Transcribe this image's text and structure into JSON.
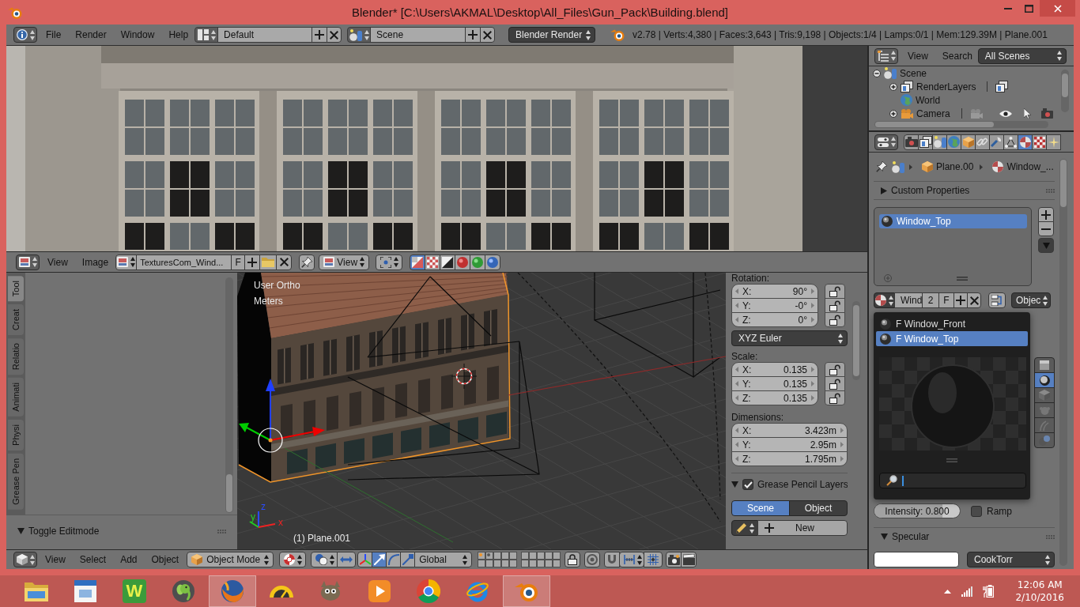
{
  "window": {
    "title": "Blender* [C:\\Users\\AKMAL\\Desktop\\All_Files\\Gun_Pack\\Building.blend]"
  },
  "info_header": {
    "menus": [
      "File",
      "Render",
      "Window",
      "Help"
    ],
    "layout": "Default",
    "scene": "Scene",
    "engine": "Blender Render",
    "stats": "v2.78 | Verts:4,380 | Faces:3,643 | Tris:9,198 | Objects:1/4 | Lamps:0/1 | Mem:129.39M | Plane.001"
  },
  "image_editor": {
    "menus": [
      "View",
      "Image"
    ],
    "image": "TexturesCom_Wind...",
    "fake_user": "F",
    "view_mode": "View",
    "channels": [
      {
        "kind": "color_alpha",
        "selected": true
      },
      {
        "kind": "alpha",
        "selected": false
      },
      {
        "kind": "z_buffer",
        "selected": false
      },
      {
        "kind": "red",
        "selected": false
      },
      {
        "kind": "green",
        "selected": false
      },
      {
        "kind": "blue",
        "selected": false
      }
    ]
  },
  "tool_shelf": {
    "tabs": [
      {
        "label": "Tool",
        "selected": true
      },
      {
        "label": "Creat",
        "selected": false
      },
      {
        "label": "Relatio",
        "selected": false
      },
      {
        "label": "Animati",
        "selected": false
      },
      {
        "label": "Physi",
        "selected": false
      },
      {
        "label": "Grease Pen",
        "selected": false
      }
    ],
    "operator_panel": {
      "title": "Toggle Editmode",
      "expanded": true
    }
  },
  "viewport": {
    "view": "User Ortho",
    "units": "Meters",
    "object": "(1) Plane.001",
    "axes": [
      "z",
      "y",
      "x"
    ]
  },
  "n_panel": {
    "rotation": {
      "label": "Rotation:",
      "fields": [
        {
          "axis": "X:",
          "value": "90°",
          "locked": false
        },
        {
          "axis": "Y:",
          "value": "-0°",
          "locked": false
        },
        {
          "axis": "Z:",
          "value": "0°",
          "locked": false
        }
      ]
    },
    "rotation_mode": "XYZ Euler",
    "scale": {
      "label": "Scale:",
      "fields": [
        {
          "axis": "X:",
          "value": "0.135",
          "locked": false
        },
        {
          "axis": "Y:",
          "value": "0.135",
          "locked": false
        },
        {
          "axis": "Z:",
          "value": "0.135",
          "locked": false
        }
      ]
    },
    "dimensions": {
      "label": "Dimensions:",
      "fields": [
        {
          "axis": "X:",
          "value": "3.423m"
        },
        {
          "axis": "Y:",
          "value": "2.95m"
        },
        {
          "axis": "Z:",
          "value": "1.795m"
        }
      ]
    },
    "grease_pencil": {
      "title": "Grease Pencil Layers",
      "expanded": true,
      "enabled": true,
      "sources": [
        {
          "label": "Scene",
          "selected": true
        },
        {
          "label": "Object",
          "selected": false
        }
      ],
      "new_label": "New"
    }
  },
  "view3d_header": {
    "menus": [
      "View",
      "Select",
      "Add",
      "Object"
    ],
    "mode": "Object Mode",
    "manipulators": [
      {
        "kind": "translate",
        "selected": true
      },
      {
        "kind": "rotate",
        "selected": false
      },
      {
        "kind": "scale",
        "selected": false
      }
    ],
    "orientation": "Global",
    "layers": [
      {
        "has_objects": true,
        "has_selected": true
      },
      {
        "has_objects": true,
        "has_selected": false
      },
      {
        "has_objects": false,
        "has_selected": false
      },
      {
        "has_objects": false,
        "has_selected": false
      },
      {
        "has_objects": false,
        "has_selected": false
      },
      {
        "has_objects": false,
        "has_selected": false
      },
      {
        "has_objects": false,
        "has_selected": false
      },
      {
        "has_objects": false,
        "has_selected": false
      },
      {
        "has_objects": false,
        "has_selected": false
      },
      {
        "has_objects": false,
        "has_selected": false
      },
      {
        "has_objects": false,
        "has_selected": false
      },
      {
        "has_objects": false,
        "has_selected": false
      },
      {
        "has_objects": false,
        "has_selected": false
      },
      {
        "has_objects": false,
        "has_selected": false
      },
      {
        "has_objects": false,
        "has_selected": false
      },
      {
        "has_objects": false,
        "has_selected": false
      },
      {
        "has_objects": false,
        "has_selected": false
      },
      {
        "has_objects": false,
        "has_selected": false
      },
      {
        "has_objects": false,
        "has_selected": false
      },
      {
        "has_objects": false,
        "has_selected": false
      }
    ]
  },
  "outliner": {
    "menus": [
      "View",
      "Search"
    ],
    "filter": "All Scenes",
    "tree": [
      {
        "label": "Scene",
        "kind": "scene",
        "expanded": true,
        "children": [
          {
            "label": "RenderLayers",
            "kind": "render_layers",
            "expanded": false
          },
          {
            "label": "World",
            "kind": "world"
          },
          {
            "label": "Camera",
            "kind": "camera",
            "expanded": false
          }
        ]
      }
    ]
  },
  "properties": {
    "tabs": [
      {
        "kind": "render",
        "selected": false
      },
      {
        "kind": "render_layers",
        "selected": false
      },
      {
        "kind": "scene",
        "selected": false
      },
      {
        "kind": "world",
        "selected": false
      },
      {
        "kind": "object",
        "selected": false
      },
      {
        "kind": "constraints",
        "selected": false
      },
      {
        "kind": "modifiers",
        "selected": false
      },
      {
        "kind": "data",
        "selected": false
      },
      {
        "kind": "material",
        "selected": true
      },
      {
        "kind": "texture",
        "selected": false
      },
      {
        "kind": "particles",
        "selected": false
      }
    ],
    "breadcrumb": [
      {
        "kind": "object",
        "label": "Plane.00"
      },
      {
        "kind": "material",
        "label": "Window_..."
      }
    ],
    "custom_properties": {
      "title": "Custom Properties",
      "expanded": false
    },
    "slots": [
      {
        "name": "Window_Top",
        "selected": true
      }
    ],
    "material": {
      "name": "Wind",
      "users": "2",
      "fake_user": "F",
      "link": "Objec"
    },
    "browse_menu": {
      "items": [
        {
          "label": "F Window_Front",
          "selected": false
        },
        {
          "label": "F Window_Top",
          "selected": true
        }
      ]
    },
    "preview_types": [
      {
        "kind": "flat",
        "selected": false
      },
      {
        "kind": "sphere",
        "selected": true
      },
      {
        "kind": "cube",
        "selected": false
      },
      {
        "kind": "monkey",
        "selected": false
      },
      {
        "kind": "hair",
        "selected": false
      },
      {
        "kind": "sky",
        "selected": false
      }
    ],
    "intensity": {
      "label": "Intensity: 0.800",
      "level": 0.8
    },
    "ramp": {
      "label": "Ramp",
      "checked": false
    },
    "specular": {
      "title": "Specular",
      "expanded": true,
      "shader": "CookTorr"
    }
  },
  "taskbar": {
    "apps": [
      {
        "kind": "folder",
        "highlighted": false
      },
      {
        "kind": "window",
        "highlighted": false
      },
      {
        "kind": "letter_tile",
        "letter": "W",
        "highlighted": false
      },
      {
        "kind": "elephant",
        "highlighted": false
      },
      {
        "kind": "fox",
        "highlighted": true
      },
      {
        "kind": "gauge",
        "highlighted": false
      },
      {
        "kind": "mascot",
        "highlighted": false
      },
      {
        "kind": "player",
        "highlighted": false
      },
      {
        "kind": "tricolor",
        "highlighted": false
      },
      {
        "kind": "orbit",
        "highlighted": false
      },
      {
        "kind": "ring",
        "highlighted": true
      }
    ],
    "time": "12:06 AM",
    "date": "2/10/2016"
  }
}
